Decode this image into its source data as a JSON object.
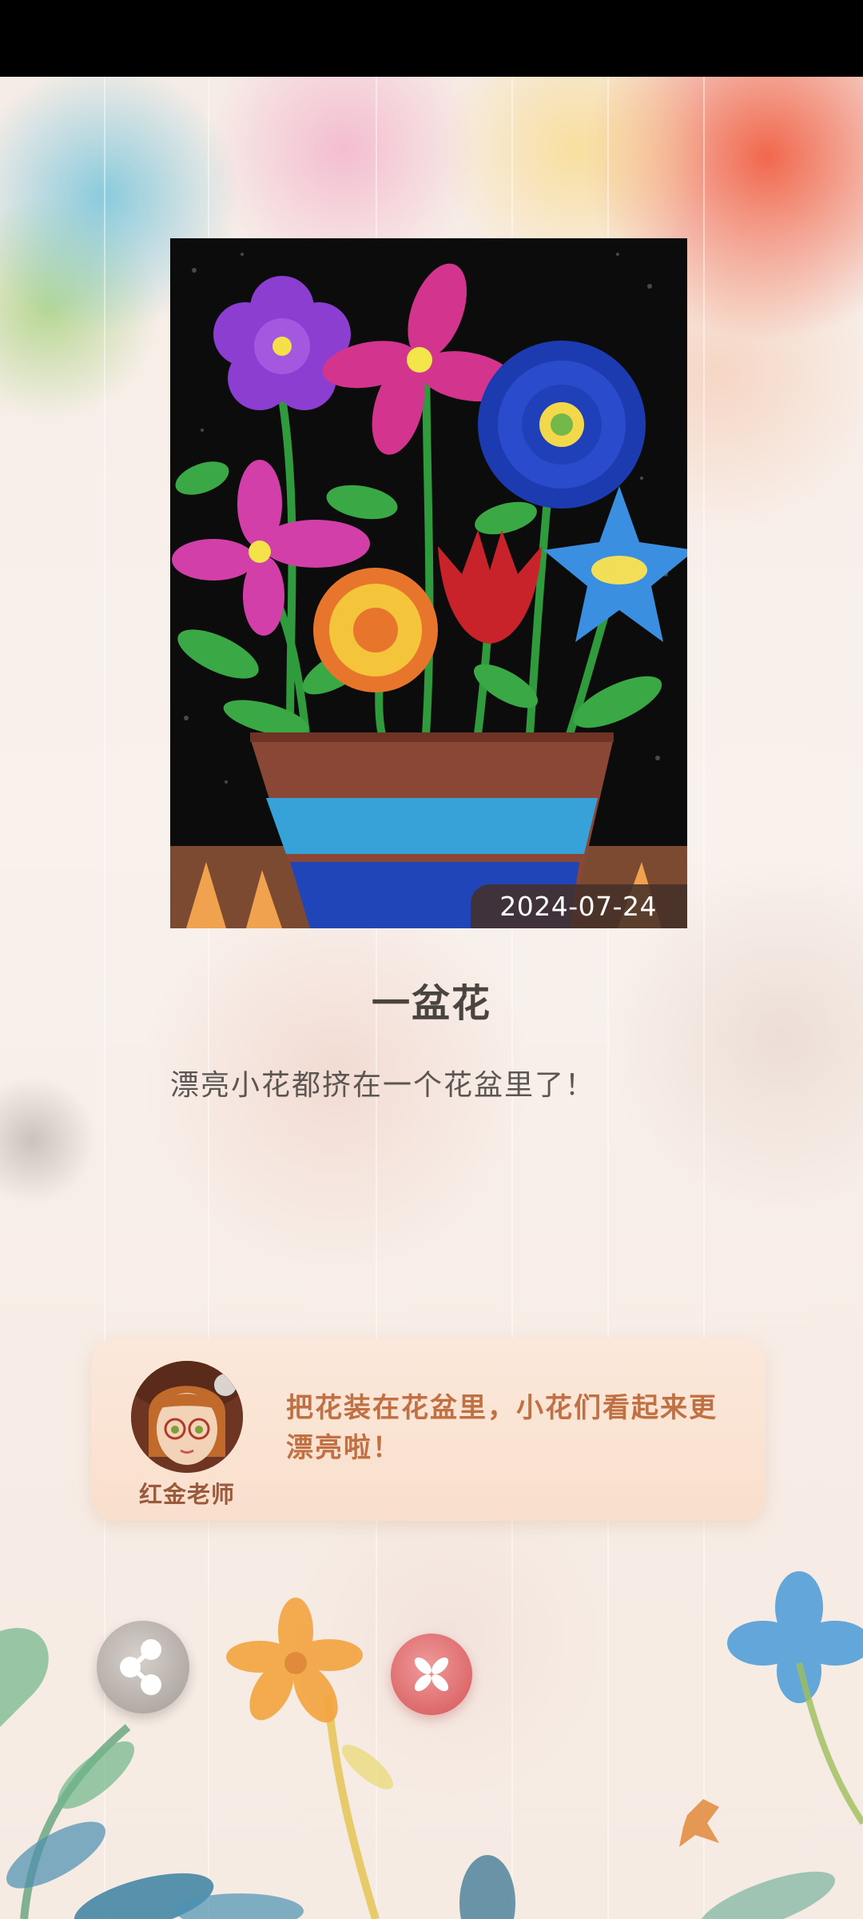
{
  "artwork": {
    "date": "2024-07-24"
  },
  "work": {
    "title": "一盆花",
    "description": "漂亮小花都挤在一个花盆里了！"
  },
  "teacher_comment": {
    "teacher_name": "红金老师",
    "comment": "把花装在花盆里，小花们看起来更漂亮啦！"
  },
  "actions": {
    "share_icon": "share-icon",
    "close_icon": "close-icon"
  },
  "colors": {
    "comment_text": "#c07043",
    "teacher_name": "#9c5a3c",
    "close_button": "#dd6a6c",
    "date_badge_bg": "#463028"
  }
}
